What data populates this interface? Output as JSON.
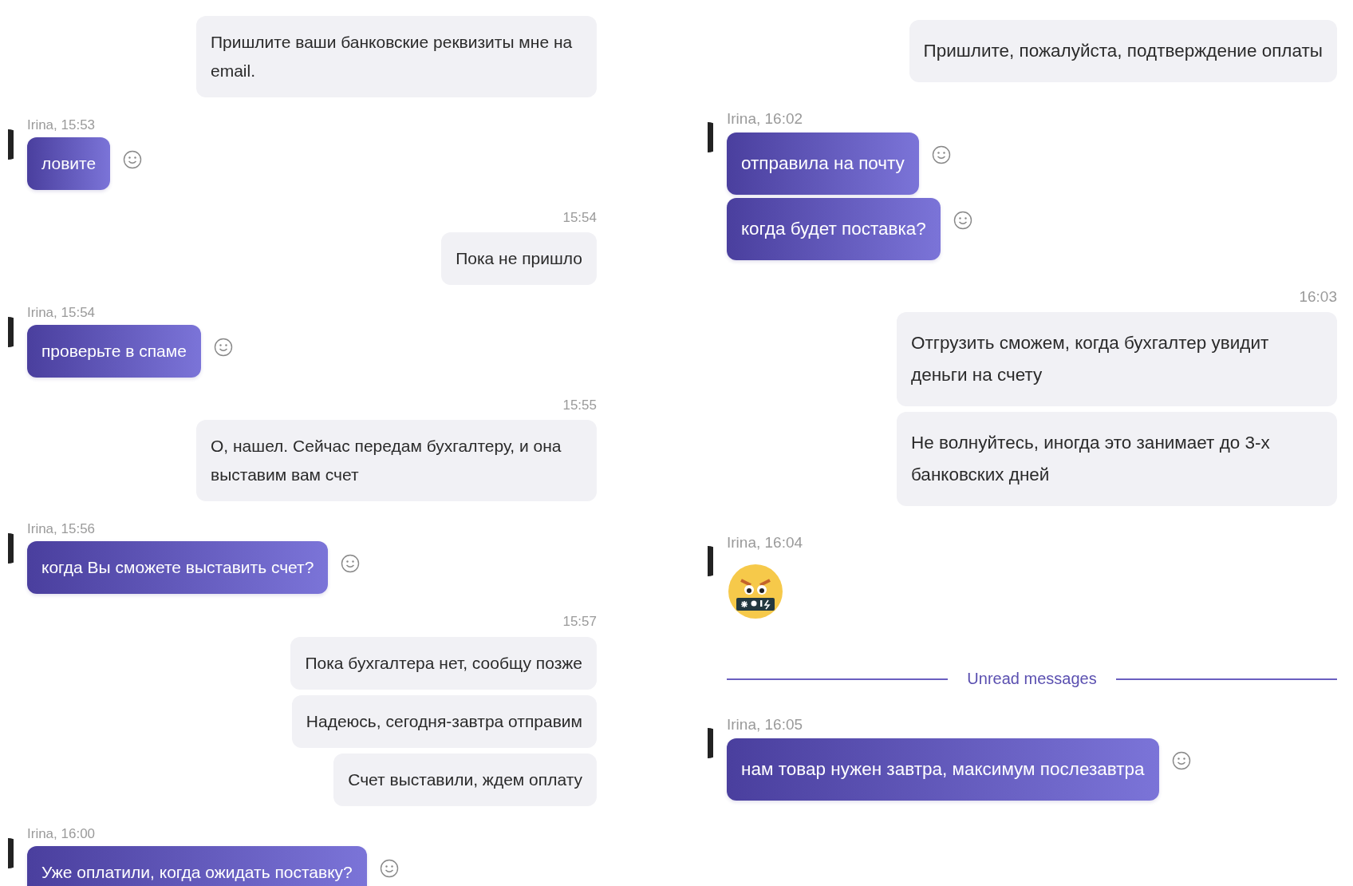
{
  "panels": [
    {
      "items": [
        {
          "kind": "outgoing",
          "texts": [
            "Пришлите ваши банковские реквизиты мне на email."
          ]
        },
        {
          "kind": "incoming",
          "meta": "Irina, 15:53",
          "texts": [
            "ловите"
          ]
        },
        {
          "kind": "outgoing",
          "time": "15:54",
          "texts": [
            "Пока не пришло"
          ]
        },
        {
          "kind": "incoming",
          "meta": "Irina, 15:54",
          "texts": [
            "проверьте в спаме"
          ]
        },
        {
          "kind": "outgoing",
          "time": "15:55",
          "texts": [
            "О, нашел. Сейчас передам бухгалтеру, и она выставим вам счет"
          ]
        },
        {
          "kind": "incoming",
          "meta": "Irina, 15:56",
          "texts": [
            "когда Вы сможете выставить счет?"
          ]
        },
        {
          "kind": "outgoing",
          "time": "15:57",
          "texts": [
            "Пока бухгалтера нет, сообщу позже",
            "Надеюсь, сегодня-завтра отправим",
            "Счет выставили, ждем оплату"
          ]
        },
        {
          "kind": "incoming",
          "meta": "Irina, 16:00",
          "texts": [
            "Уже оплатили, когда ожидать поставку?"
          ]
        }
      ]
    },
    {
      "items": [
        {
          "kind": "outgoing",
          "texts": [
            "Пришлите, пожалуйста, подтверждение оплаты"
          ]
        },
        {
          "kind": "incoming",
          "meta": "Irina, 16:02",
          "texts": [
            "отправила на почту",
            "когда будет поставка?"
          ]
        },
        {
          "kind": "outgoing",
          "time": "16:03",
          "texts": [
            "Отгрузить сможем, когда бухгалтер увидит деньги на счету",
            "Не волнуйтесь, иногда это занимает до 3-х банковских дней"
          ]
        },
        {
          "kind": "sticker",
          "meta": "Irina, 16:04"
        },
        {
          "kind": "divider",
          "label": "Unread messages"
        },
        {
          "kind": "incoming",
          "meta": "Irina, 16:05",
          "texts": [
            "нам товар нужен завтра, максимум послезавтра"
          ]
        }
      ]
    }
  ]
}
